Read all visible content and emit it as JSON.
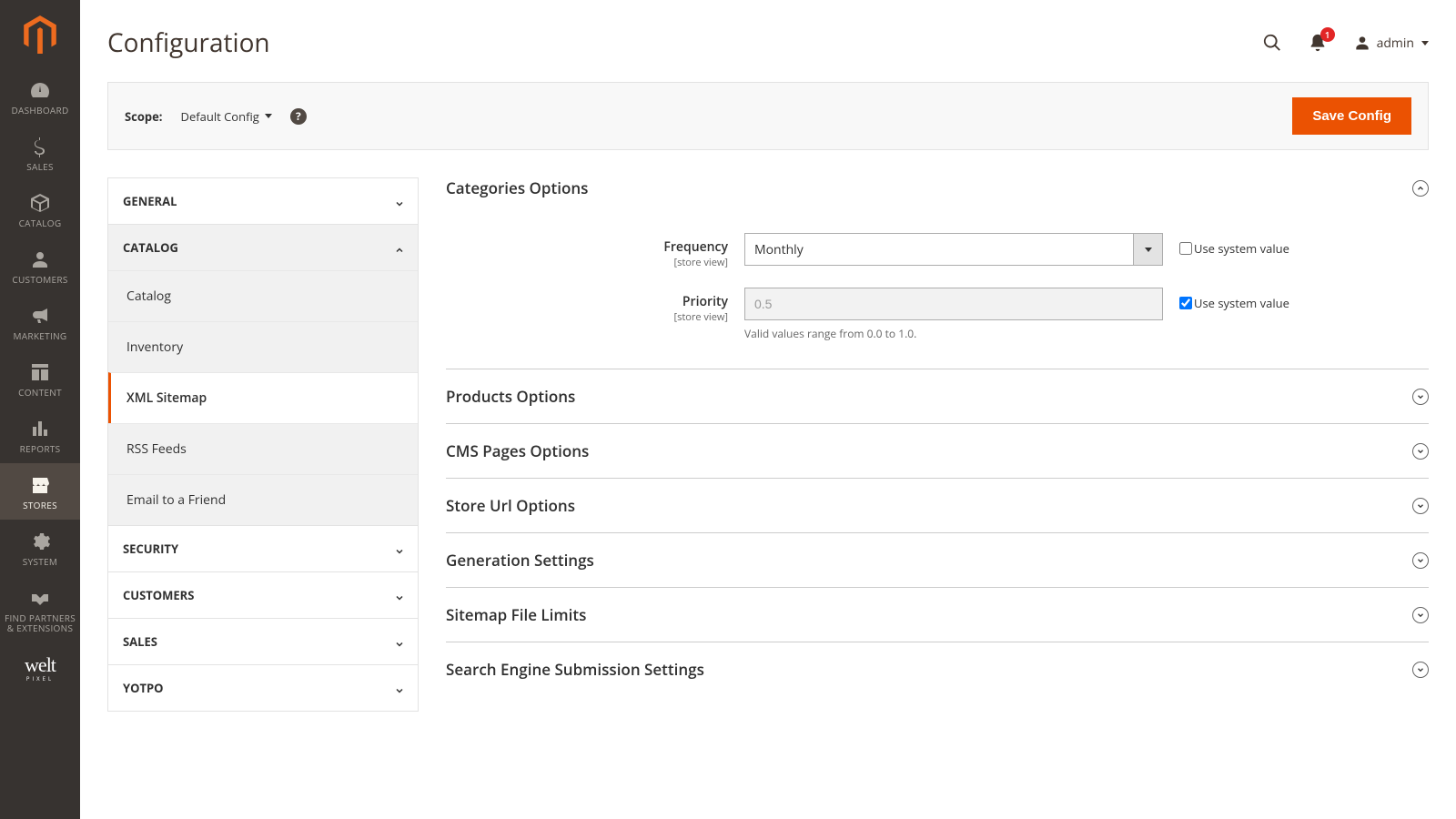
{
  "page_title": "Configuration",
  "user_name": "admin",
  "notification_count": "1",
  "scope": {
    "label": "Scope:",
    "value": "Default Config"
  },
  "save_button": "Save Config",
  "admin_nav": [
    {
      "label": "DASHBOARD"
    },
    {
      "label": "SALES"
    },
    {
      "label": "CATALOG"
    },
    {
      "label": "CUSTOMERS"
    },
    {
      "label": "MARKETING"
    },
    {
      "label": "CONTENT"
    },
    {
      "label": "REPORTS"
    },
    {
      "label": "STORES"
    },
    {
      "label": "SYSTEM"
    },
    {
      "label": "FIND PARTNERS & EXTENSIONS"
    }
  ],
  "weltpixel": {
    "main": "welt",
    "sub": "PIXEL"
  },
  "config_groups": {
    "general": "GENERAL",
    "catalog": "CATALOG",
    "catalog_items": [
      "Catalog",
      "Inventory",
      "XML Sitemap",
      "RSS Feeds",
      "Email to a Friend"
    ],
    "security": "SECURITY",
    "customers": "CUSTOMERS",
    "sales": "SALES",
    "yotpo": "YOTPO"
  },
  "sections": {
    "categories": "Categories Options",
    "products": "Products Options",
    "cms": "CMS Pages Options",
    "storeurl": "Store Url Options",
    "generation": "Generation Settings",
    "filelimits": "Sitemap File Limits",
    "submission": "Search Engine Submission Settings"
  },
  "fields": {
    "frequency": {
      "label": "Frequency",
      "scope": "[store view]",
      "value": "Monthly"
    },
    "priority": {
      "label": "Priority",
      "scope": "[store view]",
      "value": "0.5",
      "note": "Valid values range from 0.0 to 1.0."
    }
  },
  "use_system_value": "Use system value"
}
